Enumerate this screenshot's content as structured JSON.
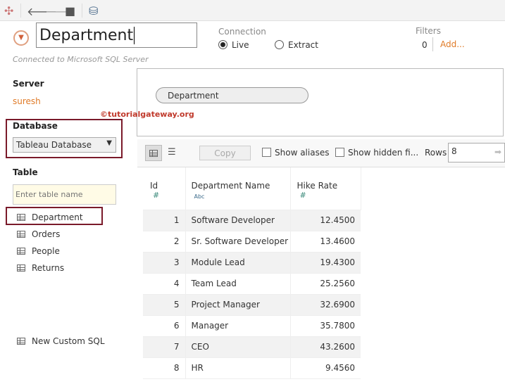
{
  "datasource": {
    "name": "Department",
    "connected_to": "Connected to Microsoft SQL Server"
  },
  "connection": {
    "label": "Connection",
    "live": "Live",
    "extract": "Extract"
  },
  "filters": {
    "label": "Filters",
    "count": "0",
    "add": "Add..."
  },
  "server": {
    "label": "Server",
    "value": "suresh"
  },
  "database": {
    "label": "Database",
    "value": "Tableau Database"
  },
  "table": {
    "label": "Table",
    "placeholder": "Enter table name",
    "items": [
      "Department",
      "Orders",
      "People",
      "Returns"
    ],
    "custom_sql": "New Custom SQL"
  },
  "canvas": {
    "table_pill": "Department",
    "watermark": "©tutorialgateway.org"
  },
  "grid_toolbar": {
    "copy": "Copy",
    "show_aliases": "Show aliases",
    "show_hidden": "Show hidden fi...",
    "rows_label": "Rows",
    "rows_value": "8"
  },
  "columns": [
    {
      "name": "Id",
      "type": "#"
    },
    {
      "name": "Department Name",
      "type": "Abc"
    },
    {
      "name": "Hike Rate",
      "type": "#"
    }
  ],
  "rows": [
    [
      "1",
      "Software Developer",
      "12.4500"
    ],
    [
      "2",
      "Sr. Software Developer",
      "13.4600"
    ],
    [
      "3",
      "Module Lead",
      "19.4300"
    ],
    [
      "4",
      "Team Lead",
      "25.2560"
    ],
    [
      "5",
      "Project Manager",
      "32.6900"
    ],
    [
      "6",
      "Manager",
      "35.7800"
    ],
    [
      "7",
      "CEO",
      "43.2600"
    ],
    [
      "8",
      "HR",
      "9.4560"
    ]
  ]
}
